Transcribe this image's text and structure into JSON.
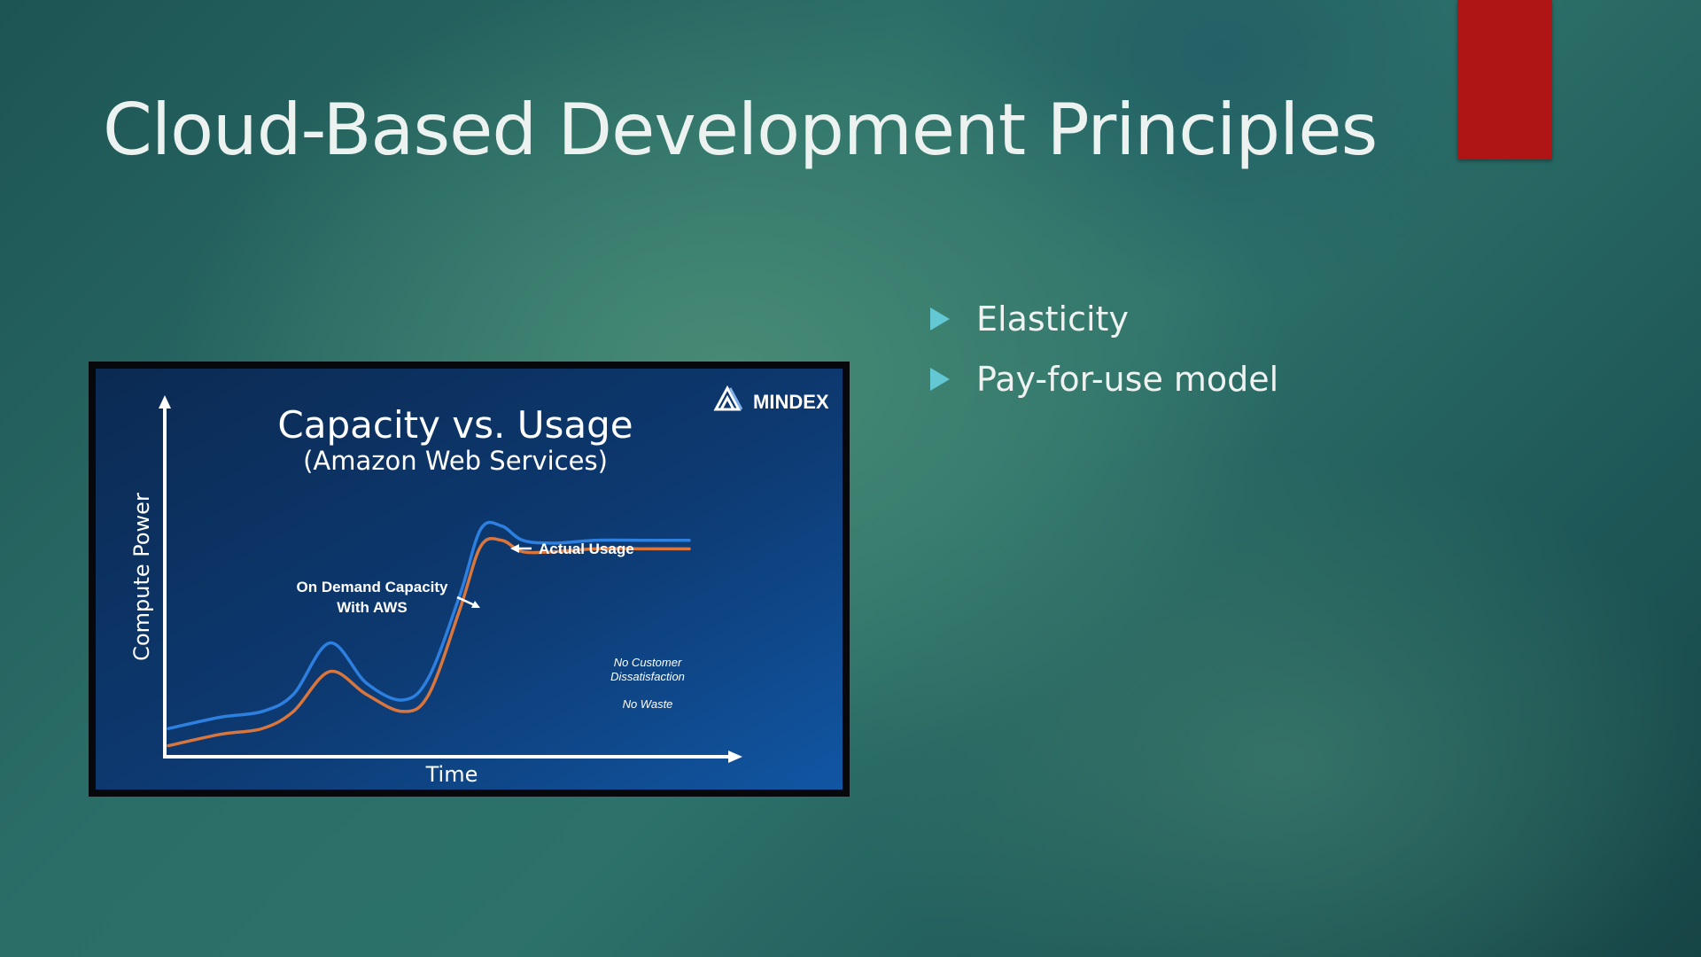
{
  "slide": {
    "title": "Cloud-Based Development Principles",
    "accent_color": "#b01515",
    "bullets": [
      "Elasticity",
      "Pay-for-use model"
    ],
    "bullet_icon": "triangle-right-icon",
    "bullet_color": "#63c7d4"
  },
  "chart_data": {
    "type": "line",
    "title": "Capacity vs. Usage",
    "subtitle": "(Amazon Web Services)",
    "xlabel": "Time",
    "ylabel": "Compute Power",
    "brand": "MINDEX",
    "xlim": [
      0,
      100
    ],
    "ylim": [
      0,
      100
    ],
    "grid": false,
    "x": [
      0,
      10,
      18,
      24,
      31,
      38,
      45,
      50,
      56,
      60,
      64,
      68,
      74,
      82,
      92,
      100
    ],
    "series": [
      {
        "name": "On Demand Capacity With AWS",
        "color": "#2d7fe0",
        "values": [
          8,
          12,
          14,
          20,
          38,
          24,
          18,
          26,
          55,
          78,
          79,
          74,
          73,
          74,
          74,
          74
        ]
      },
      {
        "name": "Actual Usage",
        "color": "#d8763e",
        "values": [
          2,
          6,
          8,
          14,
          28,
          20,
          14,
          20,
          50,
          72,
          74,
          70,
          70,
          71,
          71,
          71
        ]
      }
    ],
    "annotations": [
      {
        "text": "On Demand Capacity",
        "line2": "With AWS"
      },
      {
        "text": "Actual Usage"
      },
      {
        "text": "No Customer",
        "line2": "Dissatisfaction"
      },
      {
        "text": "No Waste"
      }
    ]
  }
}
